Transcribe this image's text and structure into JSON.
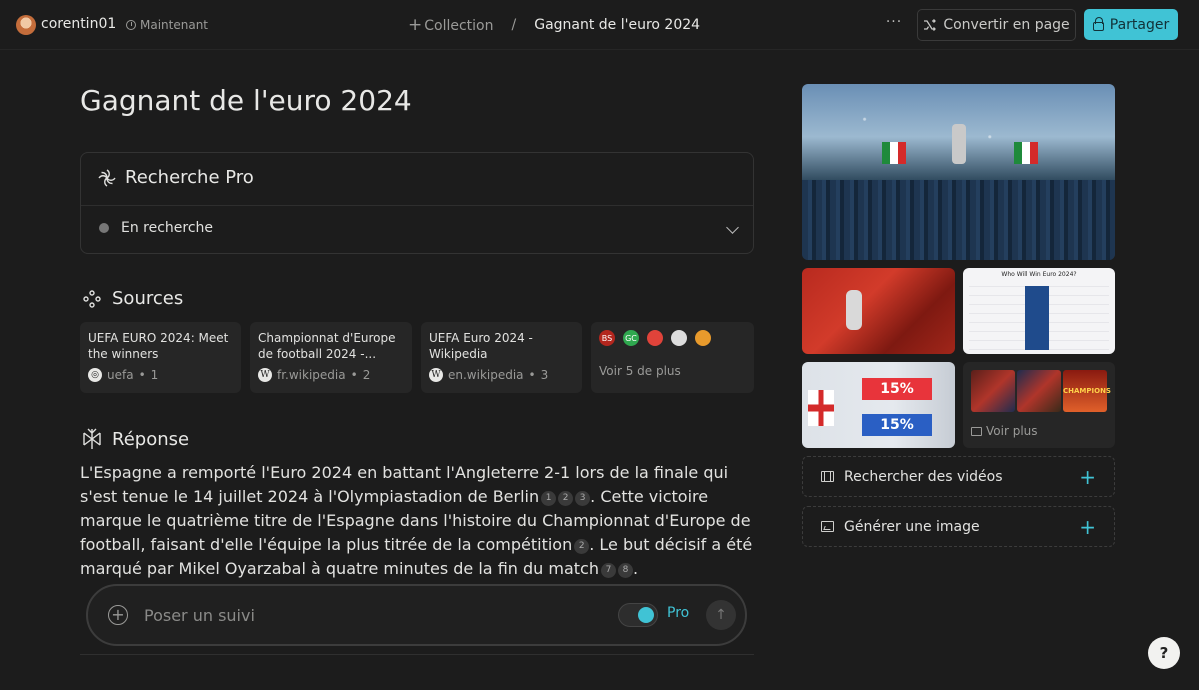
{
  "header": {
    "username": "corentin01",
    "timestamp": "Maintenant",
    "breadcrumb_collection": "Collection",
    "breadcrumb_separator": "/",
    "breadcrumb_current": "Gagnant de l'euro 2024",
    "more_label": "···",
    "convert_label": "Convertir en page",
    "share_label": "Partager"
  },
  "page": {
    "title": "Gagnant de l'euro 2024"
  },
  "pro_search": {
    "title": "Recherche Pro",
    "status": "En recherche"
  },
  "sources": {
    "heading": "Sources",
    "items": [
      {
        "title": "UEFA EURO 2024: Meet the winners",
        "domain": "uefa",
        "index": "1"
      },
      {
        "title": "Championnat d'Europe de football 2024 -...",
        "domain": "fr.wikipedia",
        "index": "2"
      },
      {
        "title": "UEFA Euro 2024 - Wikipedia",
        "domain": "en.wikipedia",
        "index": "3"
      }
    ],
    "more_icons": [
      "BS",
      "GC",
      "",
      "",
      ""
    ],
    "see_more": "Voir 5 de plus"
  },
  "answer": {
    "heading": "Réponse",
    "parts": [
      "L'Espagne a remporté l'Euro 2024 en battant l'Angleterre 2-1 lors de la finale qui s'est tenue le 14 juillet 2024 à l'Olympiastadion de Berlin",
      ". Cette victoire marque le quatrième titre de l'Espagne dans l'histoire du Championnat d'Europe de football, faisant d'elle l'équipe la plus titrée de la compétition",
      ". Le but décisif a été marqué par Mikel Oyarzabal à quatre minutes de la fin du match",
      "."
    ],
    "citations": {
      "group1": [
        "1",
        "2",
        "3"
      ],
      "group2": [
        "2"
      ],
      "group3": [
        "7",
        "8"
      ]
    }
  },
  "followup": {
    "placeholder": "Poser un suivi",
    "pro_label": "Pro"
  },
  "sidebar": {
    "images_table_title": "Who Will Win Euro 2024?",
    "stat1": "15%",
    "stat2": "15%",
    "thumb_text": "CHAMPIONS",
    "see_more": "Voir plus",
    "search_videos": "Rechercher des vidéos",
    "generate_image": "Générer une image"
  },
  "colors": {
    "accent": "#40c3d5",
    "background": "#1c1c1c"
  },
  "help_label": "?"
}
